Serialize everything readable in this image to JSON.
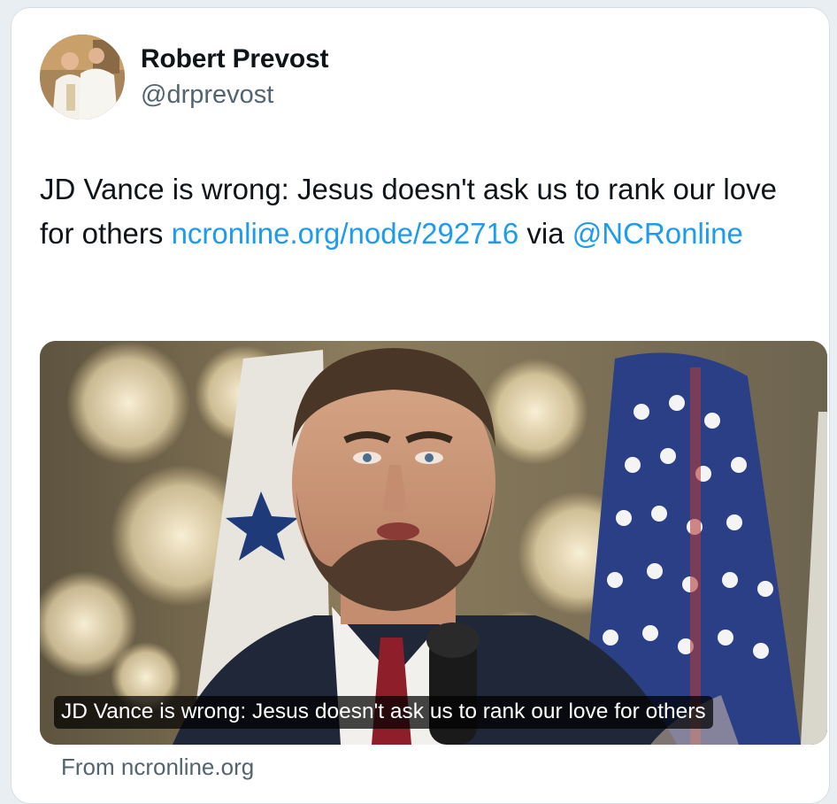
{
  "author": {
    "name": "Robert Prevost",
    "handle": "@drprevost"
  },
  "tweet": {
    "text_prefix": "JD Vance is wrong: Jesus doesn't ask us to rank our love for others ",
    "link_text": "ncronline.org/node/292716",
    "text_middle": " via ",
    "mention": "@NCRonline"
  },
  "link_card": {
    "headline": "JD Vance is wrong: Jesus doesn't ask us to rank our love for others",
    "source": "From ncronline.org"
  },
  "colors": {
    "link": "#1d9bf0",
    "text": "#0f1419",
    "secondary": "#536471"
  }
}
